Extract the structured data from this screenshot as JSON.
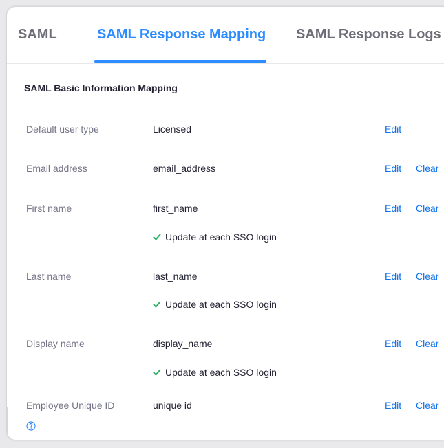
{
  "tabs": [
    {
      "label": "SAML",
      "active": false
    },
    {
      "label": "SAML Response Mapping",
      "active": true
    },
    {
      "label": "SAML Response Logs",
      "active": false
    }
  ],
  "section_title": "SAML Basic Information Mapping",
  "actions": {
    "edit": "Edit",
    "clear": "Clear"
  },
  "rows": [
    {
      "label": "Default user type",
      "value": "Licensed"
    },
    {
      "label": "Email address",
      "value": "email_address"
    },
    {
      "label": "First name",
      "value": "first_name",
      "update": "Update at each SSO login"
    },
    {
      "label": "Last name",
      "value": "last_name",
      "update": "Update at each SSO login"
    },
    {
      "label": "Display name",
      "value": "display_name",
      "update": "Update at each SSO login"
    },
    {
      "label": "Employee Unique ID",
      "value": "unique id"
    }
  ],
  "colors": {
    "accent": "#2d8cff",
    "link": "#0e72ed",
    "check": "#27ae60"
  },
  "icons": {
    "check": "check-icon",
    "help": "help-circle-icon"
  }
}
